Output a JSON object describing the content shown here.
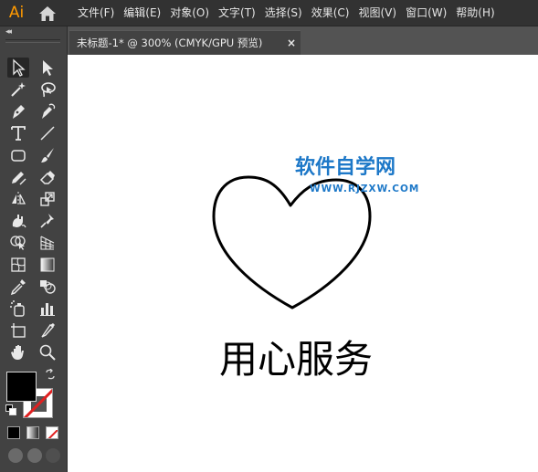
{
  "app": {
    "logo": "Ai"
  },
  "menubar": {
    "items": [
      "文件(F)",
      "编辑(E)",
      "对象(O)",
      "文字(T)",
      "选择(S)",
      "效果(C)",
      "视图(V)",
      "窗口(W)",
      "帮助(H)"
    ]
  },
  "toolbar": {
    "collapse_glyph": "◂◂",
    "fill_color": "#000000",
    "stroke_color": "none"
  },
  "document": {
    "tab_title": "未标题-1* @ 300% (CMYK/GPU 预览)",
    "close_glyph": "×"
  },
  "canvas": {
    "watermark_title": "软件自学网",
    "watermark_url": "WWW.RJZXW.COM",
    "caption": "用心服务",
    "watermark_color": "#1d78c8"
  }
}
